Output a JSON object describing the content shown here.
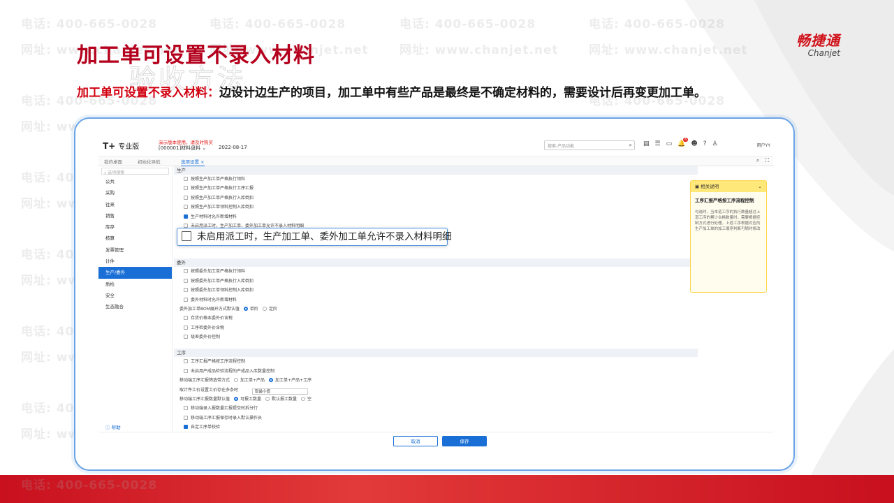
{
  "slide": {
    "title": "加工单可设置不录入材料",
    "ghost_title": "验收方法",
    "subtitle_highlight": "加工单可设置不录入材料：",
    "subtitle_text": "边设计边生产的项目，加工单中有些产品是最终是不确定材料的，需要设计后再变更加工单。",
    "logo_cn": "畅捷通",
    "logo_en": "Chanjet",
    "watermark_phone": "电话: 400-665-0028",
    "watermark_site": "网址: www.chanjet.net",
    "colors": {
      "brand_red": "#b4001c",
      "accent_blue": "#1a6fd6",
      "frame_blue": "#6aa3e6"
    }
  },
  "app": {
    "brand": "T+",
    "edition": "专业版",
    "demo_warning": "演示版本使用，请及时购买",
    "account": "[000001]材料盘料",
    "date": "2022-08-17",
    "search_placeholder": "搜索-产品功能",
    "notification_count": "6",
    "user": "用户YY",
    "tabs": {
      "desk": "我的桌面",
      "wizard": "初始化导航",
      "options": "选项设置"
    },
    "sidebar": {
      "search_placeholder": "选项搜索",
      "items": [
        "公共",
        "采购",
        "往来",
        "销售",
        "库存",
        "核算",
        "发票管理",
        "计件",
        "生产/委外",
        "质检",
        "安全",
        "生态融合"
      ],
      "help": "帮助"
    },
    "sections": {
      "production": {
        "title": "生产",
        "options": [
          "按照生产加工单严格执行领料",
          "按照生产加工单严格执行工序汇报",
          "按照生产加工单严格执行入库倒扣",
          "按照生产加工单领料控制入库倒扣",
          "生产材料时允许新增材料",
          "未启用派工时，生产加工单、委外加工单允许不录入材料明细"
        ]
      },
      "outsource": {
        "title": "委外",
        "options": [
          "按照委外加工单严格执行领料",
          "按照委外加工单严格执行入库倒扣",
          "按照委外加工单领料控制入库倒扣",
          "委外材料时允许新增材料"
        ],
        "bom_label": "委外加工单BOM展开方式默认值",
        "bom_opt1": "单阶",
        "bom_opt2": "定阶",
        "options2": [
          "存货价格本委外价含税",
          "工序检委外价含税",
          "级差委外价控制"
        ]
      },
      "process": {
        "title": "工序",
        "options": [
          "工序汇报严格按工序流程控制",
          "未启用产成品检验流程的产成品入库数量控制"
        ],
        "mobile_label": "移动端工序汇报筛选带方式",
        "mobile_opt1": "加工单+产品",
        "mobile_opt2": "加工单+产品+工序",
        "piece_label": "取计件工价设置工价存在多条时",
        "piece_value": "取最小值",
        "qty_label": "移动端工序汇报数量默认值",
        "qty_opt1": "可报工数量",
        "qty_opt2": "默认报工数量",
        "qty_opt3": "空",
        "options2": [
          "移动端录入报数量汇报提交时拆分行",
          "移动端工序汇报保存时录入默认操作员",
          "自定工序单校验"
        ]
      }
    },
    "callout": "未启用派工时，生产加工单、委外加工单允许不录入材料明细",
    "info_panel": {
      "header": "相关说明",
      "title": "工序汇报严格按工序流程控制",
      "body": "勾选时，当本道工序的执行数量超过上道工序的累计合格数量时，需要根据控制方式进行处理。上道工序根据对应的生产加工单的加工顺序判断可随时修改"
    },
    "buttons": {
      "cancel": "取消",
      "save": "保存"
    }
  }
}
